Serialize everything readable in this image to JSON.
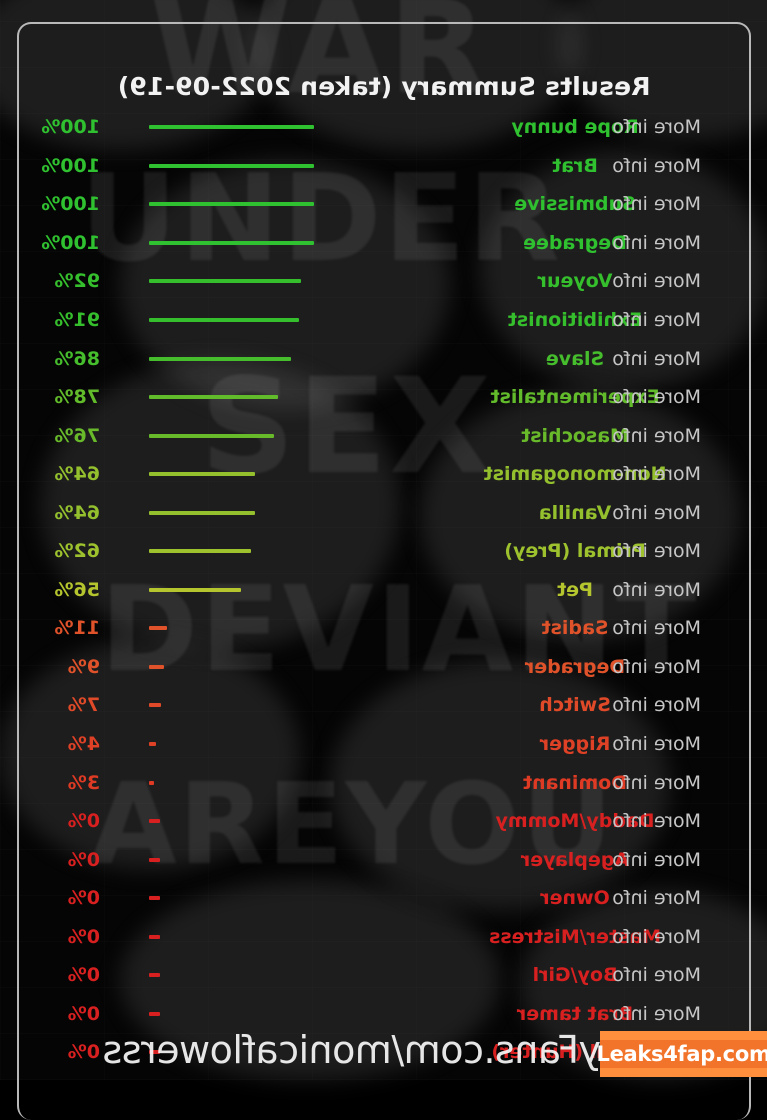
{
  "card": {
    "title": "Results Summary (taken 2022-09-19)",
    "more_info_label": "More info"
  },
  "colors": {
    "high_green": "#2fc12f",
    "mid_green": "#6fbf2a",
    "yellow_green": "#b5c52e",
    "low_red": "#e0522a",
    "zero_red": "#d82020",
    "border": "#b9b9b9",
    "title_text": "#f2f2f2",
    "more_info_text": "#c6c6c6",
    "badge_bg": "#ff8f3c",
    "badge_text": "#ffffff"
  },
  "watermark": {
    "text": "OnlyFans.com/monicaflowerss",
    "badge_text": "Leaks4fap.com"
  },
  "background": {
    "graffiti_words": [
      "WAR",
      "UNDER",
      "SEX",
      "IN",
      "DEVIANT",
      "AREYOU",
      "RE"
    ]
  },
  "chart_data": {
    "type": "bar",
    "title": "Results Summary (taken 2022-09-19)",
    "xlabel": "",
    "ylabel": "",
    "xlim": [
      0,
      100
    ],
    "grid": false,
    "legend": null,
    "orientation": "horizontal",
    "categories": [
      "Rope bunny",
      "Brat",
      "Submissive",
      "Degradee",
      "Voyeur",
      "Exhibitionist",
      "Slave",
      "Experimentalist",
      "Masochist",
      "Non-monogamist",
      "Vanilla",
      "Primal (Prey)",
      "Pet",
      "Sadist",
      "Degrader",
      "Switch",
      "Rigger",
      "Dominant",
      "Daddy/Mommy",
      "Ageplayer",
      "Owner",
      "Master/Mistress",
      "Boy/Girl",
      "Brat tamer",
      "Primal (Hunter)"
    ],
    "values": [
      100,
      100,
      100,
      100,
      92,
      91,
      86,
      78,
      76,
      64,
      64,
      62,
      56,
      11,
      9,
      7,
      4,
      3,
      0,
      0,
      0,
      0,
      0,
      0,
      0
    ],
    "value_labels": [
      "100%",
      "100%",
      "100%",
      "100%",
      "92%",
      "91%",
      "86%",
      "78%",
      "76%",
      "64%",
      "64%",
      "62%",
      "56%",
      "11%",
      "9%",
      "7%",
      "4%",
      "3%",
      "0%",
      "0%",
      "0%",
      "0%",
      "0%",
      "0%",
      "0%"
    ],
    "bar_colors": [
      "#2fc12f",
      "#2fc12f",
      "#2fc12f",
      "#2fc12f",
      "#35bf2d",
      "#36bf2d",
      "#45bd2c",
      "#62bb2b",
      "#68ba2b",
      "#94c02e",
      "#94c02e",
      "#9dc22e",
      "#b5c52e",
      "#e0522a",
      "#e0522a",
      "#e04a28",
      "#df4126",
      "#de3a24",
      "#d82020",
      "#d82020",
      "#d82020",
      "#d82020",
      "#d82020",
      "#d82020",
      "#d82020"
    ],
    "rows": [
      {
        "label": "Rope bunny",
        "value": 100,
        "value_label": "100%",
        "color": "#2fc12f",
        "action": "More info"
      },
      {
        "label": "Brat",
        "value": 100,
        "value_label": "100%",
        "color": "#2fc12f",
        "action": "More info"
      },
      {
        "label": "Submissive",
        "value": 100,
        "value_label": "100%",
        "color": "#2fc12f",
        "action": "More info"
      },
      {
        "label": "Degradee",
        "value": 100,
        "value_label": "100%",
        "color": "#2fc12f",
        "action": "More info"
      },
      {
        "label": "Voyeur",
        "value": 92,
        "value_label": "92%",
        "color": "#35bf2d",
        "action": "More info"
      },
      {
        "label": "Exhibitionist",
        "value": 91,
        "value_label": "91%",
        "color": "#36bf2d",
        "action": "More info"
      },
      {
        "label": "Slave",
        "value": 86,
        "value_label": "86%",
        "color": "#45bd2c",
        "action": "More info"
      },
      {
        "label": "Experimentalist",
        "value": 78,
        "value_label": "78%",
        "color": "#62bb2b",
        "action": "More info"
      },
      {
        "label": "Masochist",
        "value": 76,
        "value_label": "76%",
        "color": "#68ba2b",
        "action": "More info"
      },
      {
        "label": "Non-monogamist",
        "value": 64,
        "value_label": "64%",
        "color": "#94c02e",
        "action": "More info"
      },
      {
        "label": "Vanilla",
        "value": 64,
        "value_label": "64%",
        "color": "#94c02e",
        "action": "More info"
      },
      {
        "label": "Primal (Prey)",
        "value": 62,
        "value_label": "62%",
        "color": "#9dc22e",
        "action": "More info"
      },
      {
        "label": "Pet",
        "value": 56,
        "value_label": "56%",
        "color": "#b5c52e",
        "action": "More info"
      },
      {
        "label": "Sadist",
        "value": 11,
        "value_label": "11%",
        "color": "#e0522a",
        "action": "More info"
      },
      {
        "label": "Degrader",
        "value": 9,
        "value_label": "9%",
        "color": "#e0522a",
        "action": "More info"
      },
      {
        "label": "Switch",
        "value": 7,
        "value_label": "7%",
        "color": "#e04a28",
        "action": "More info"
      },
      {
        "label": "Rigger",
        "value": 4,
        "value_label": "4%",
        "color": "#df4126",
        "action": "More info"
      },
      {
        "label": "Dominant",
        "value": 3,
        "value_label": "3%",
        "color": "#de3a24",
        "action": "More info"
      },
      {
        "label": "Daddy/Mommy",
        "value": 0,
        "value_label": "0%",
        "color": "#d82020",
        "action": "More info"
      },
      {
        "label": "Ageplayer",
        "value": 0,
        "value_label": "0%",
        "color": "#d82020",
        "action": "More info"
      },
      {
        "label": "Owner",
        "value": 0,
        "value_label": "0%",
        "color": "#d82020",
        "action": "More info"
      },
      {
        "label": "Master/Mistress",
        "value": 0,
        "value_label": "0%",
        "color": "#d82020",
        "action": "More info"
      },
      {
        "label": "Boy/Girl",
        "value": 0,
        "value_label": "0%",
        "color": "#d82020",
        "action": "More info"
      },
      {
        "label": "Brat tamer",
        "value": 0,
        "value_label": "0%",
        "color": "#d82020",
        "action": "More info"
      },
      {
        "label": "Primal (Hunter)",
        "value": 0,
        "value_label": "0%",
        "color": "#d82020",
        "action": "More info"
      }
    ]
  }
}
